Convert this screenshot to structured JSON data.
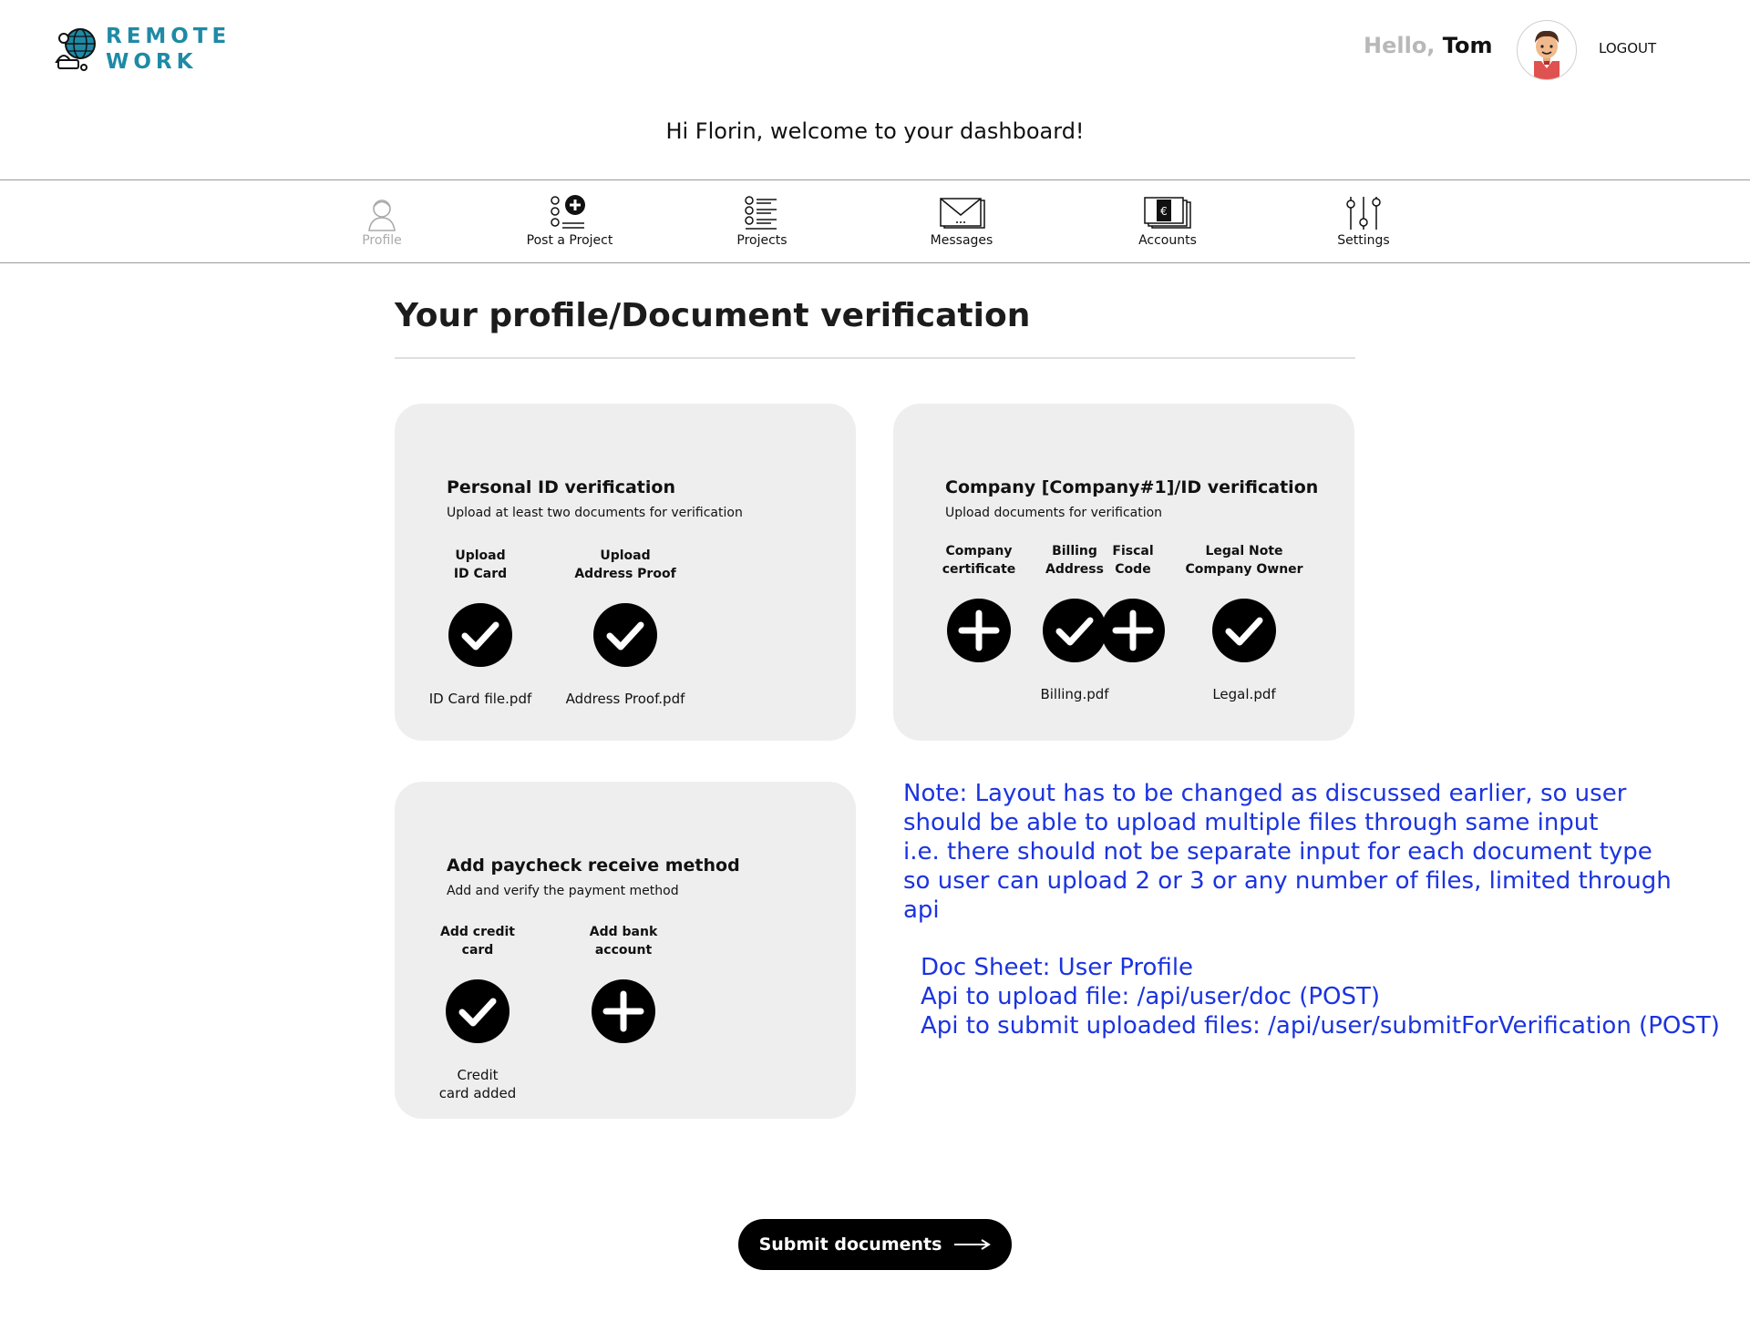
{
  "header": {
    "logo_line1": "REMOTE",
    "logo_line2": "WORK",
    "hello_prefix": "Hello,",
    "user_name": "Tom",
    "logout_label": "LOGOUT"
  },
  "welcome": "Hi Florin, welcome to your dashboard!",
  "nav": {
    "items": [
      {
        "label": "Profile",
        "icon": "profile-icon",
        "active": false
      },
      {
        "label": "Post a Project",
        "icon": "post-project-icon"
      },
      {
        "label": "Projects",
        "icon": "projects-list-icon"
      },
      {
        "label": "Messages",
        "icon": "messages-icon"
      },
      {
        "label": "Accounts",
        "icon": "accounts-icon"
      },
      {
        "label": "Settings",
        "icon": "settings-icon"
      }
    ]
  },
  "page_title": "Your profile/Document verification",
  "personal": {
    "title": "Personal ID verification",
    "subtitle": "Upload at least two documents for verification",
    "items": [
      {
        "label": "Upload\nID Card",
        "status": "check",
        "file": "ID Card file.pdf"
      },
      {
        "label": "Upload\nAddress Proof",
        "status": "check",
        "file": "Address Proof.pdf"
      }
    ]
  },
  "company": {
    "title": "Company [Company#1]/ID verification",
    "subtitle": "Upload documents for verification",
    "items": [
      {
        "label": "Company\ncertificate",
        "status": "add",
        "file": ""
      },
      {
        "label": "Billing\nAddress",
        "status": "check",
        "file": "Billing.pdf"
      },
      {
        "label": "Fiscal\nCode",
        "status": "add",
        "file": ""
      },
      {
        "label": "Legal Note\nCompany Owner",
        "status": "check",
        "file": "Legal.pdf"
      }
    ]
  },
  "paycheck": {
    "title": "Add paycheck receive method",
    "subtitle": "Add and verify the payment method",
    "items": [
      {
        "label": "Add credit\ncard",
        "status": "check",
        "file": "Credit\ncard added"
      },
      {
        "label": "Add bank\naccount",
        "status": "add",
        "file": ""
      }
    ]
  },
  "note": {
    "lines": [
      "Note: Layout has to be changed as discussed earlier, so user",
      "should be able to upload multiple files through same input",
      "i.e. there should not be separate input for each document type",
      "so user can upload 2 or 3 or any number of files, limited through",
      "api"
    ],
    "api_lines": [
      "Doc Sheet: User Profile",
      "Api to upload file: /api/user/doc (POST)",
      "Api to submit uploaded files: /api/user/submitForVerification (POST)"
    ]
  },
  "submit_label": "Submit documents",
  "colors": {
    "brand": "#1e8aa6",
    "note": "#1b33e0",
    "card_bg": "#eeeeee"
  }
}
